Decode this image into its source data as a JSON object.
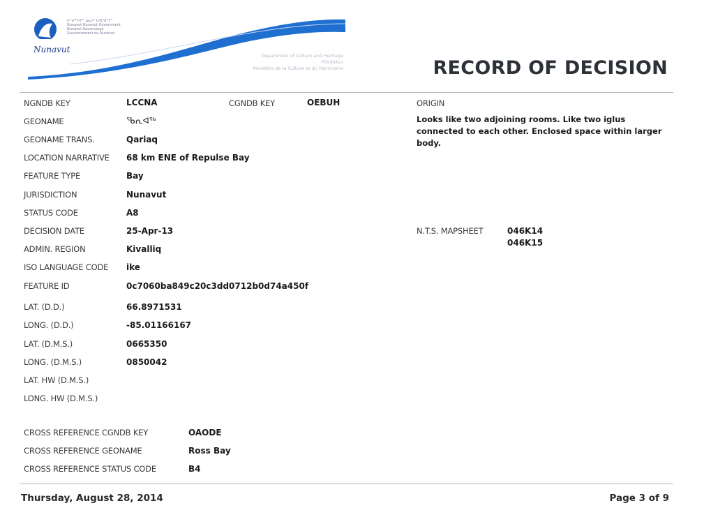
{
  "header": {
    "title": "RECORD OF DECISION",
    "logo_text": "Nunavut",
    "gov_lines": [
      "ᐅᓐᓂᕐᔪᐊᖅ ᓄᓇᕗᑦ ᒐᕙᒪᒃᑯᖏᑦ",
      "Nunavut Nunavut Government",
      "Nunavut Kavamanga",
      "Gouvernement du Nunavut"
    ],
    "department_lines": [
      "Department of Culture and Heritage",
      "Pilirijikkut",
      "Ministère de la Culture et du Patrimoine"
    ],
    "colors": {
      "brand_blue": "#1b5fc0",
      "swoosh_blue": "#1f6fd1"
    }
  },
  "fields": [
    {
      "label": "NGNDB KEY",
      "value": "LCCNA"
    },
    {
      "label": "GEONAME",
      "value": "ᖃᕆᐊᖅ"
    },
    {
      "label": "GEONAME TRANS.",
      "value": "Qariaq"
    },
    {
      "label": "LOCATION NARRATIVE",
      "value": "68 km ENE of Repulse Bay"
    },
    {
      "label": "FEATURE TYPE",
      "value": "Bay"
    },
    {
      "label": "JURISDICTION",
      "value": "Nunavut"
    },
    {
      "label": "STATUS CODE",
      "value": "A8"
    },
    {
      "label": "DECISION DATE",
      "value": "25-Apr-13"
    },
    {
      "label": "ADMIN. REGION",
      "value": "Kivalliq"
    },
    {
      "label": "ISO LANGUAGE CODE",
      "value": "ike"
    },
    {
      "label": "FEATURE ID",
      "value": "0c7060ba849c20c3dd0712b0d74a450f"
    },
    {
      "label": "LAT. (D.D.)",
      "value": "66.8971531"
    },
    {
      "label": "LONG. (D.D.)",
      "value": "-85.01166167"
    },
    {
      "label": "LAT. (D.M.S.)",
      "value": "0665350"
    },
    {
      "label": "LONG. (D.M.S.)",
      "value": "0850042"
    },
    {
      "label": "LAT. HW (D.M.S.)",
      "value": ""
    },
    {
      "label": "LONG. HW (D.M.S.)",
      "value": ""
    }
  ],
  "cgndb": {
    "label": "CGNDB KEY",
    "value": "OEBUH"
  },
  "origin": {
    "label": "ORIGIN",
    "text": "Looks like two adjoining rooms. Like two iglus connected to each other. Enclosed space within larger body."
  },
  "nts": {
    "label": "N.T.S. MAPSHEET",
    "values": [
      "046K14",
      "046K15"
    ]
  },
  "cross_reference": [
    {
      "label": "CROSS REFERENCE CGNDB KEY",
      "value": "OAODE"
    },
    {
      "label": "CROSS REFERENCE GEONAME",
      "value": "Ross Bay"
    },
    {
      "label": "CROSS REFERENCE STATUS CODE",
      "value": "B4"
    }
  ],
  "footer": {
    "date": "Thursday, August 28, 2014",
    "page": "Page 3 of 9"
  }
}
